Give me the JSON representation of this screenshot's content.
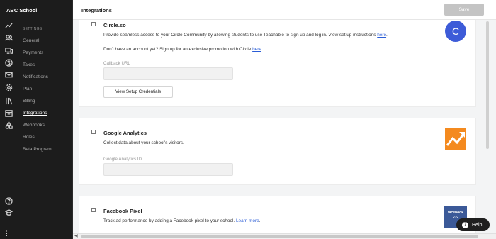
{
  "app": {
    "school_name": "ABC School"
  },
  "sidebar": {
    "section_heading": "SETTINGS",
    "items": [
      {
        "label": "General",
        "active": false
      },
      {
        "label": "Payments",
        "active": false
      },
      {
        "label": "Taxes",
        "active": false
      },
      {
        "label": "Notifications",
        "active": false
      },
      {
        "label": "Plan",
        "active": false
      },
      {
        "label": "Billing",
        "active": false
      },
      {
        "label": "Integrations",
        "active": true
      },
      {
        "label": "Webhooks",
        "active": false
      },
      {
        "label": "Roles",
        "active": false
      },
      {
        "label": "Beta Program",
        "active": false
      }
    ]
  },
  "rail_icons": [
    "trend-icon",
    "users-icon",
    "monitor-icon",
    "dollar-icon",
    "mail-icon",
    "gear-icon",
    "library-icon",
    "calendar-icon",
    "tools-icon",
    "help-circle-icon",
    "graduation-icon"
  ],
  "header": {
    "title": "Integrations",
    "save_label": "Save"
  },
  "integrations": {
    "circle": {
      "name": "Circle.so",
      "description": "Provide seamless access to your Circle Community by allowing students to use Teachable to sign up and log in. View set up instructions ",
      "description_link": "here",
      "promo": "Don't have an account yet? Sign up for an exclusive promotion with Circle ",
      "promo_link": "here",
      "field_label": "Callback URL",
      "field_value": "",
      "button_label": "View Setup Credentials",
      "logo_letter": "C"
    },
    "google_analytics": {
      "name": "Google Analytics",
      "description": "Collect data about your school's visitors.",
      "field_label": "Google Analytics ID",
      "field_value": ""
    },
    "facebook_pixel": {
      "name": "Facebook Pixel",
      "description": "Track ad performance by adding a Facebook pixel to your school. ",
      "description_link": "Learn more",
      "description_end": ".",
      "logo_text": "facebook",
      "logo_sub": "</>"
    }
  },
  "help": {
    "label": "Help",
    "icon_glyph": "?"
  },
  "colors": {
    "sidebar_bg": "#1c1c1c",
    "link": "#2a5cd6",
    "circle_logo": "#3d5bd8",
    "ga_orange": "#f48a1f",
    "fb_blue": "#3b5998",
    "save_disabled": "#c4c4c4"
  }
}
